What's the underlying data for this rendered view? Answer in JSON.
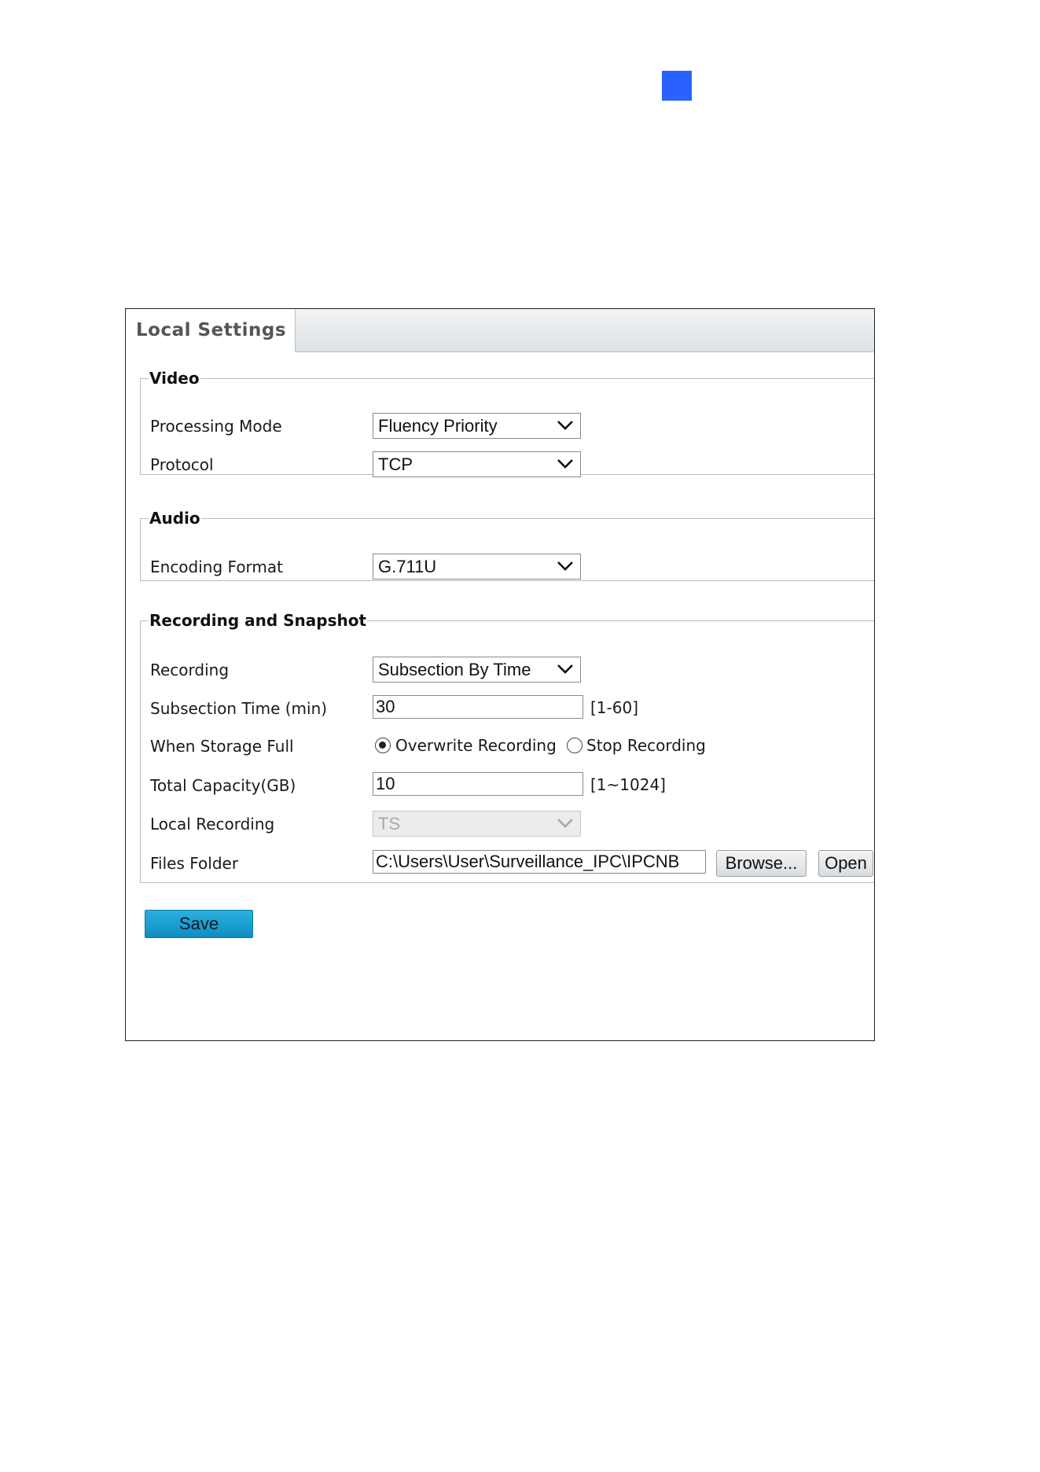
{
  "tab": {
    "title": "Local Settings"
  },
  "video": {
    "legend": "Video",
    "processing_mode": {
      "label": "Processing Mode",
      "value": "Fluency Priority"
    },
    "protocol": {
      "label": "Protocol",
      "value": "TCP"
    }
  },
  "audio": {
    "legend": "Audio",
    "encoding_format": {
      "label": "Encoding Format",
      "value": "G.711U"
    }
  },
  "recording": {
    "legend": "Recording and Snapshot",
    "recording": {
      "label": "Recording",
      "value": "Subsection By Time"
    },
    "subsection_time": {
      "label": "Subsection Time (min)",
      "value": "30",
      "range": "[1-60]"
    },
    "storage_full": {
      "label": "When Storage Full",
      "option1": "Overwrite Recording",
      "option2": "Stop Recording",
      "selected": "Overwrite Recording"
    },
    "total_capacity": {
      "label": "Total Capacity(GB)",
      "value": "10",
      "range": "[1~1024]"
    },
    "local_recording": {
      "label": "Local Recording",
      "value": "TS"
    },
    "files_folder": {
      "label": "Files Folder",
      "value": "C:\\Users\\User\\Surveillance_IPC\\IPCNB",
      "browse": "Browse...",
      "open": "Open"
    }
  },
  "actions": {
    "save": "Save"
  },
  "colors": {
    "marker": "#2962ff",
    "save_button": "#1a9fd4"
  }
}
